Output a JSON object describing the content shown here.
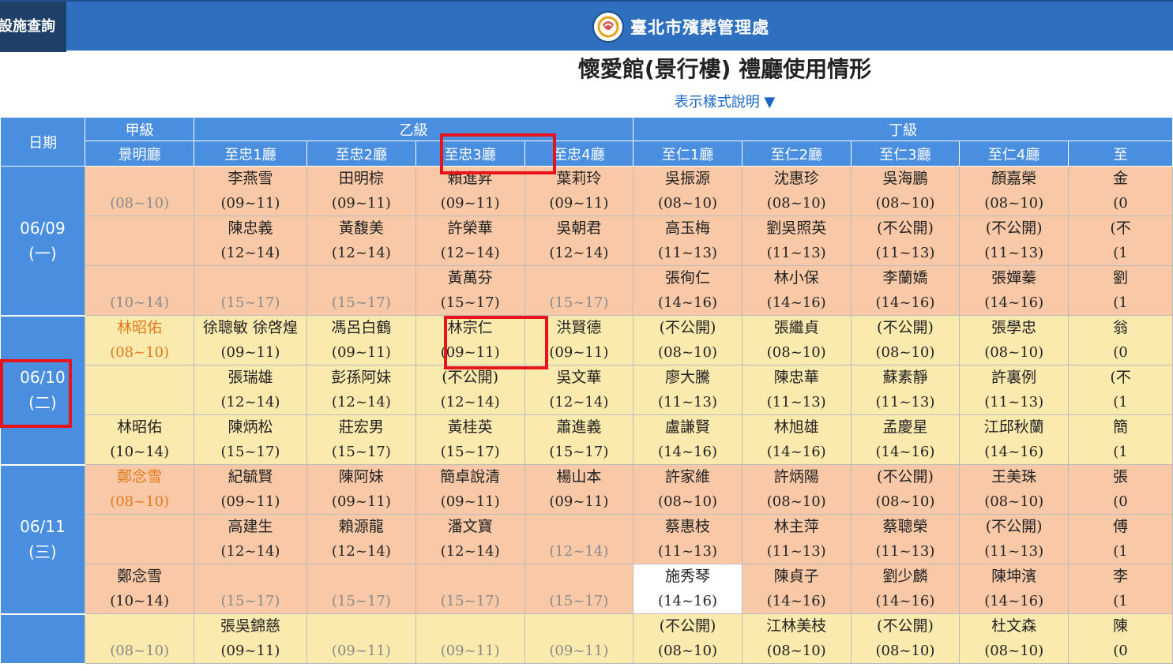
{
  "topbar": {
    "facility_label": "設施查詢",
    "brand": "臺北市殯葬管理處"
  },
  "page_title": "懷愛館(景行樓) 禮廳使用情形",
  "legend_link": "表示樣式說明 ▼",
  "colors": {
    "header_blue": "#4a8ee0",
    "topbar_blue": "#2f6fbf",
    "salmon": "#f9c9a7",
    "yellow": "#fbeaae",
    "highlight_red": "#e8141b",
    "gold_text": "#e07a1c"
  },
  "table": {
    "date_header": "日期",
    "grades": [
      {
        "label": "甲級"
      },
      {
        "label": "乙級"
      },
      {
        "label": "丁級"
      }
    ],
    "halls": [
      "景明廳",
      "至忠1廳",
      "至忠2廳",
      "至忠3廳",
      "至忠4廳",
      "至仁1廳",
      "至仁2廳",
      "至仁3廳",
      "至仁4廳",
      "至"
    ],
    "days": [
      {
        "date": "06/09",
        "weekday": "(一)",
        "rows": [
          {
            "bg": "salmon",
            "cells": [
              {
                "name": "",
                "time": "(08~10)",
                "dim": true
              },
              {
                "name": "李燕雪",
                "time": "(09~11)"
              },
              {
                "name": "田明棕",
                "time": "(09~11)"
              },
              {
                "name": "賴進昇",
                "time": "(09~11)"
              },
              {
                "name": "葉莉玲",
                "time": "(09~11)"
              },
              {
                "name": "吳振源",
                "time": "(08~10)"
              },
              {
                "name": "沈惠珍",
                "time": "(08~10)"
              },
              {
                "name": "吳海鵬",
                "time": "(08~10)"
              },
              {
                "name": "顏嘉榮",
                "time": "(08~10)"
              },
              {
                "name": "金",
                "time": "(0"
              }
            ]
          },
          {
            "bg": "salmon",
            "cells": [
              {
                "name": "",
                "time": ""
              },
              {
                "name": "陳忠義",
                "time": "(12~14)"
              },
              {
                "name": "黃馥美",
                "time": "(12~14)"
              },
              {
                "name": "許榮華",
                "time": "(12~14)"
              },
              {
                "name": "吳朝君",
                "time": "(12~14)"
              },
              {
                "name": "高玉梅",
                "time": "(11~13)"
              },
              {
                "name": "劉吳照英",
                "time": "(11~13)"
              },
              {
                "name": "(不公開)",
                "time": "(11~13)"
              },
              {
                "name": "(不公開)",
                "time": "(11~13)"
              },
              {
                "name": "(不",
                "time": "(1"
              }
            ]
          },
          {
            "bg": "salmon",
            "cells": [
              {
                "name": "",
                "time": "(10~14)",
                "dim": true
              },
              {
                "name": "",
                "time": "(15~17)",
                "dim": true
              },
              {
                "name": "",
                "time": "(15~17)",
                "dim": true
              },
              {
                "name": "黃萬芬",
                "time": "(15~17)"
              },
              {
                "name": "",
                "time": "(15~17)",
                "dim": true
              },
              {
                "name": "張徇仁",
                "time": "(14~16)"
              },
              {
                "name": "林小保",
                "time": "(14~16)"
              },
              {
                "name": "李蘭嬌",
                "time": "(14~16)"
              },
              {
                "name": "張嬋蓁",
                "time": "(14~16)"
              },
              {
                "name": "劉",
                "time": "(1"
              }
            ]
          }
        ]
      },
      {
        "date": "06/10",
        "weekday": "(二)",
        "rows": [
          {
            "bg": "yellow",
            "cells": [
              {
                "name": "林昭佑",
                "time": "(08~10)",
                "gold": true
              },
              {
                "name": "徐聰敏 徐啓煌",
                "time": "(09~11)"
              },
              {
                "name": "馮呂白鶴",
                "time": "(09~11)"
              },
              {
                "name": "林宗仁",
                "time": "(09~11)"
              },
              {
                "name": "洪賢德",
                "time": "(09~11)"
              },
              {
                "name": "(不公開)",
                "time": "(08~10)"
              },
              {
                "name": "張繼貞",
                "time": "(08~10)"
              },
              {
                "name": "(不公開)",
                "time": "(08~10)"
              },
              {
                "name": "張學忠",
                "time": "(08~10)"
              },
              {
                "name": "翁",
                "time": "(0"
              }
            ]
          },
          {
            "bg": "yellow",
            "cells": [
              {
                "name": "",
                "time": ""
              },
              {
                "name": "張瑞雄",
                "time": "(12~14)"
              },
              {
                "name": "彭孫阿妹",
                "time": "(12~14)"
              },
              {
                "name": "(不公開)",
                "time": "(12~14)"
              },
              {
                "name": "吳文華",
                "time": "(12~14)"
              },
              {
                "name": "廖大騰",
                "time": "(11~13)"
              },
              {
                "name": "陳忠華",
                "time": "(11~13)"
              },
              {
                "name": "蘇素靜",
                "time": "(11~13)"
              },
              {
                "name": "許裏例",
                "time": "(11~13)"
              },
              {
                "name": "(不",
                "time": "(1"
              }
            ]
          },
          {
            "bg": "yellow",
            "cells": [
              {
                "name": "林昭佑",
                "time": "(10~14)"
              },
              {
                "name": "陳炳松",
                "time": "(15~17)"
              },
              {
                "name": "莊宏男",
                "time": "(15~17)"
              },
              {
                "name": "黃桂英",
                "time": "(15~17)"
              },
              {
                "name": "蕭進義",
                "time": "(15~17)"
              },
              {
                "name": "盧謙賢",
                "time": "(14~16)"
              },
              {
                "name": "林旭雄",
                "time": "(14~16)"
              },
              {
                "name": "孟慶星",
                "time": "(14~16)"
              },
              {
                "name": "江邱秋蘭",
                "time": "(14~16)"
              },
              {
                "name": "簡",
                "time": "(1"
              }
            ]
          }
        ]
      },
      {
        "date": "06/11",
        "weekday": "(三)",
        "rows": [
          {
            "bg": "salmon",
            "cells": [
              {
                "name": "鄭念雪",
                "time": "(08~10)",
                "gold": true
              },
              {
                "name": "紀毓賢",
                "time": "(09~11)"
              },
              {
                "name": "陳阿妹",
                "time": "(09~11)"
              },
              {
                "name": "簡卓說清",
                "time": "(09~11)"
              },
              {
                "name": "楊山本",
                "time": "(09~11)"
              },
              {
                "name": "許家維",
                "time": "(08~10)"
              },
              {
                "name": "許炳陽",
                "time": "(08~10)"
              },
              {
                "name": "(不公開)",
                "time": "(08~10)"
              },
              {
                "name": "王美珠",
                "time": "(08~10)"
              },
              {
                "name": "張",
                "time": "(0"
              }
            ]
          },
          {
            "bg": "salmon",
            "cells": [
              {
                "name": "",
                "time": ""
              },
              {
                "name": "高建生",
                "time": "(12~14)"
              },
              {
                "name": "賴源龍",
                "time": "(12~14)"
              },
              {
                "name": "潘文寶",
                "time": "(12~14)"
              },
              {
                "name": "",
                "time": "(12~14)",
                "dim": true
              },
              {
                "name": "蔡惠枝",
                "time": "(11~13)"
              },
              {
                "name": "林主萍",
                "time": "(11~13)"
              },
              {
                "name": "蔡聰榮",
                "time": "(11~13)"
              },
              {
                "name": "(不公開)",
                "time": "(11~13)"
              },
              {
                "name": "傅",
                "time": "(1"
              }
            ]
          },
          {
            "bg": "salmon",
            "cells": [
              {
                "name": "鄭念雪",
                "time": "(10~14)"
              },
              {
                "name": "",
                "time": "(15~17)",
                "dim": true
              },
              {
                "name": "",
                "time": "(15~17)",
                "dim": true
              },
              {
                "name": "",
                "time": "(15~17)",
                "dim": true
              },
              {
                "name": "",
                "time": "(15~17)",
                "dim": true
              },
              {
                "name": "施秀琴",
                "time": "(14~16)",
                "white": true
              },
              {
                "name": "陳貞子",
                "time": "(14~16)"
              },
              {
                "name": "劉少麟",
                "time": "(14~16)"
              },
              {
                "name": "陳坤濱",
                "time": "(14~16)"
              },
              {
                "name": "李",
                "time": "(1"
              }
            ]
          }
        ]
      },
      {
        "date": "",
        "weekday": "",
        "rows": [
          {
            "bg": "yellow",
            "cells": [
              {
                "name": "",
                "time": "(08~10)",
                "dim": true
              },
              {
                "name": "張吳錦慈",
                "time": "(09~11)"
              },
              {
                "name": "",
                "time": "(09~11)",
                "dim": true
              },
              {
                "name": "",
                "time": "(09~11)",
                "dim": true
              },
              {
                "name": "",
                "time": "(09~11)",
                "dim": true
              },
              {
                "name": "(不公開)",
                "time": "(08~10)"
              },
              {
                "name": "江林美枝",
                "time": "(08~10)"
              },
              {
                "name": "(不公開)",
                "time": "(08~10)"
              },
              {
                "name": "杜文森",
                "time": "(08~10)"
              },
              {
                "name": "陳",
                "time": "(0"
              }
            ]
          }
        ]
      }
    ]
  }
}
